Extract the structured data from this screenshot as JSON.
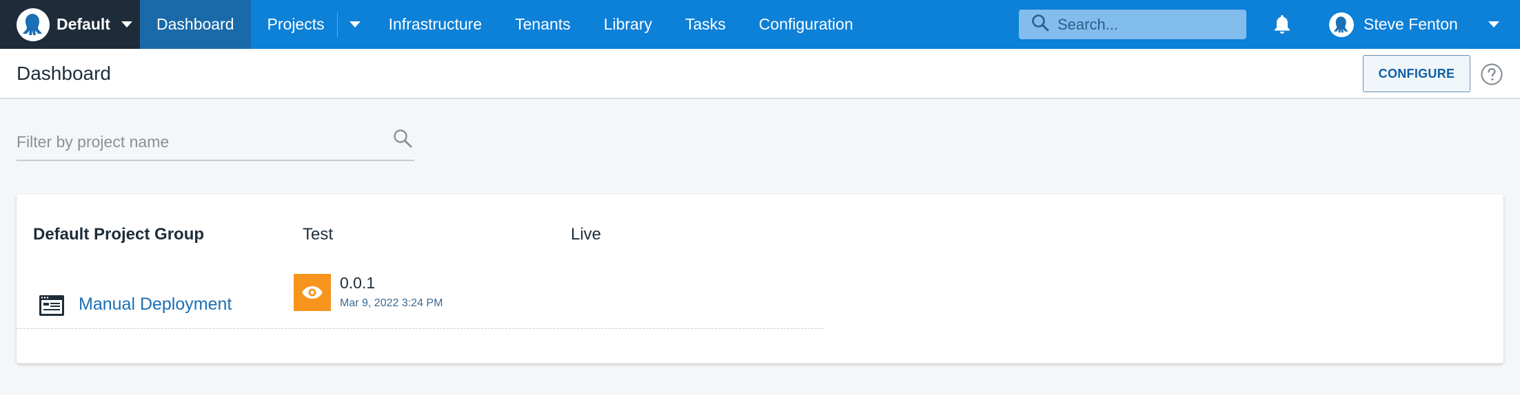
{
  "nav": {
    "space": "Default",
    "items": [
      {
        "label": "Dashboard",
        "active": true
      },
      {
        "label": "Projects"
      },
      {
        "label": "Infrastructure"
      },
      {
        "label": "Tenants"
      },
      {
        "label": "Library"
      },
      {
        "label": "Tasks"
      },
      {
        "label": "Configuration"
      }
    ],
    "search_placeholder": "Search...",
    "user_name": "Steve Fenton"
  },
  "page": {
    "title": "Dashboard",
    "configure_label": "CONFIGURE"
  },
  "filter": {
    "placeholder": "Filter by project name",
    "value": ""
  },
  "group": {
    "name": "Default Project Group",
    "environments": [
      "Test",
      "Live"
    ],
    "projects": [
      {
        "name": "Manual Deployment",
        "test_release": {
          "version": "0.0.1",
          "date": "Mar 9, 2022 3:24 PM",
          "status_color": "#f7941d"
        }
      }
    ]
  },
  "colors": {
    "nav_bg": "#0d80d8",
    "space_bg": "#1e2b38",
    "active_nav": "#1a6aa9",
    "link": "#1a6fb5"
  }
}
